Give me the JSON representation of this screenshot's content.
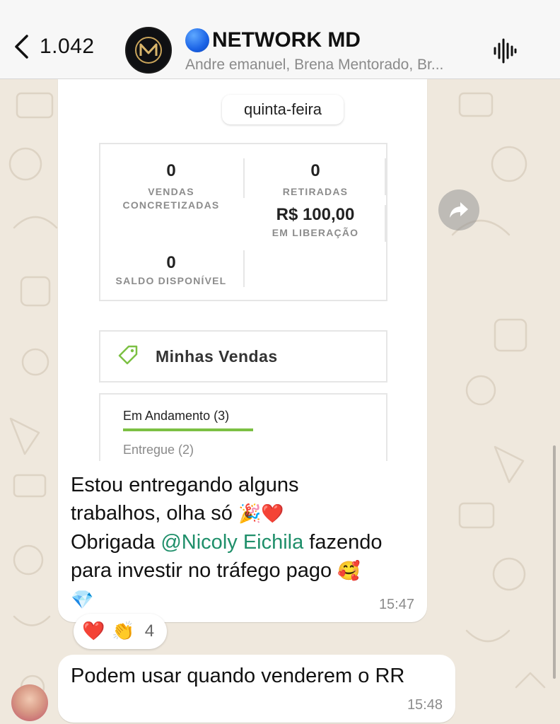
{
  "header": {
    "back_count": "1.042",
    "group_title": "NETWORK MD",
    "group_members": "Andre emanuel, Brena Mentorado, Br..."
  },
  "shared_screenshot": {
    "day_label": "quinta-feira",
    "stats": {
      "vendas_value": "0",
      "vendas_label_1": "VENDAS",
      "vendas_label_2": "CONCRETIZADAS",
      "retiradas_value": "0",
      "retiradas_label": "RETIRADAS",
      "liberacao_value": "R$ 100,00",
      "liberacao_label": "EM LIBERAÇÃO",
      "saldo_value": "0",
      "saldo_label": "SALDO DISPONÍVEL"
    },
    "sales_title": "Minhas Vendas",
    "tab_active": "Em Andamento (3)",
    "tab_inactive": "Entregue (2)"
  },
  "message_1": {
    "line1": "Estou entregando alguns",
    "line2": "trabalhos, olha só",
    "line2_emojis": "🎉❤️",
    "line3_prefix": "Obrigada ",
    "mention": "@Nicoly Eichila",
    "line3_suffix": " fazendo",
    "line4": "para investir no tráfego pago",
    "line4_emoji": "🥰",
    "line5_emoji": "💎",
    "time": "15:47"
  },
  "reactions": {
    "emoji_1": "❤️",
    "emoji_2": "👏",
    "count": "4"
  },
  "message_2": {
    "text": "Podem usar quando venderem o RR",
    "time": "15:48"
  },
  "colors": {
    "accent_green": "#7cc043",
    "mention_green": "#1f8f6a",
    "header_bg": "#f7f7f7",
    "wallpaper": "#efe8dd"
  },
  "icons": [
    "back-chevron-icon",
    "group-avatar-logo",
    "blue-circle-emoji",
    "voice-call-icon",
    "forward-icon",
    "tag-icon"
  ]
}
